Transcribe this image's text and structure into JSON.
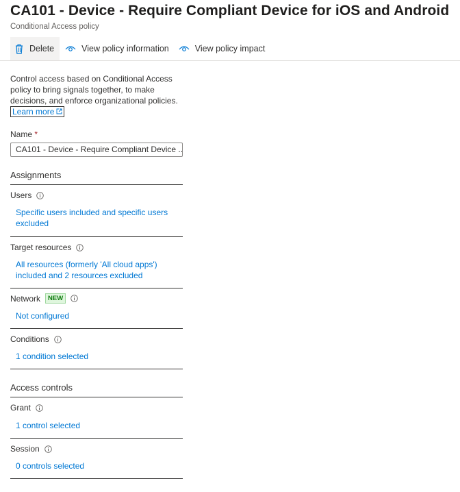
{
  "header": {
    "title": "CA101 - Device - Require Compliant Device for iOS and Android",
    "subtitle": "Conditional Access policy"
  },
  "toolbar": {
    "delete_label": "Delete",
    "view_info_label": "View policy information",
    "view_impact_label": "View policy impact"
  },
  "intro": {
    "text": "Control access based on Conditional Access policy to bring signals together, to make decisions, and enforce organizational policies.",
    "learn_more": "Learn more"
  },
  "name_field": {
    "label": "Name",
    "required_mark": "*",
    "value": "CA101 - Device - Require Compliant Device ..."
  },
  "assignments": {
    "heading": "Assignments",
    "users": {
      "label": "Users",
      "value": "Specific users included and specific users excluded"
    },
    "target_resources": {
      "label": "Target resources",
      "value": "All resources (formerly 'All cloud apps') included and 2 resources excluded"
    },
    "network": {
      "label": "Network",
      "badge": "NEW",
      "value": "Not configured"
    },
    "conditions": {
      "label": "Conditions",
      "value": "1 condition selected"
    }
  },
  "access_controls": {
    "heading": "Access controls",
    "grant": {
      "label": "Grant",
      "value": "1 control selected"
    },
    "session": {
      "label": "Session",
      "value": "0 controls selected"
    }
  },
  "colors": {
    "link": "#0078d4",
    "badge_green": "#107c10",
    "text": "#323130"
  },
  "icons": [
    "trash-icon",
    "eye-icon",
    "info-icon",
    "external-link-icon"
  ]
}
